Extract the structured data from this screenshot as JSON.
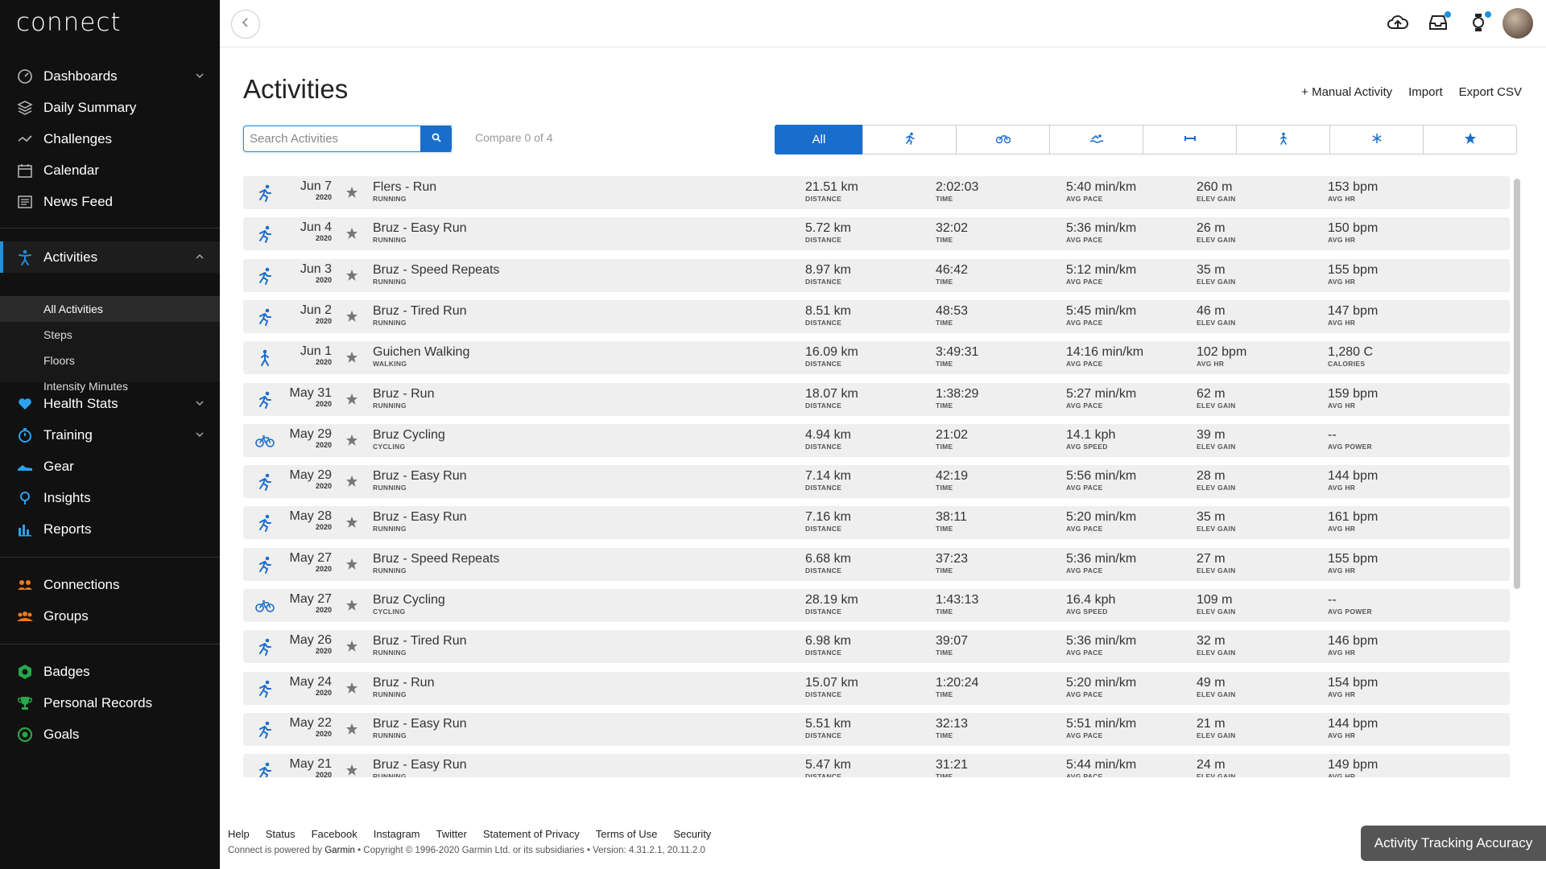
{
  "app": {
    "logo": "connect"
  },
  "sidebar": {
    "items": [
      {
        "label": "Dashboards",
        "icon": "gauge-icon",
        "chevron": "down"
      },
      {
        "label": "Daily Summary",
        "icon": "layers-icon"
      },
      {
        "label": "Challenges",
        "icon": "challenge-icon"
      },
      {
        "label": "Calendar",
        "icon": "calendar-icon"
      },
      {
        "label": "News Feed",
        "icon": "newsfeed-icon"
      }
    ],
    "activities": {
      "label": "Activities",
      "icon": "activities-icon",
      "chevron": "up",
      "sub": [
        "All Activities",
        "Steps",
        "Floors",
        "Intensity Minutes"
      ]
    },
    "items2": [
      {
        "label": "Health Stats",
        "icon": "heart-icon",
        "chevron": "down"
      },
      {
        "label": "Training",
        "icon": "stopwatch-icon",
        "chevron": "down"
      },
      {
        "label": "Gear",
        "icon": "shoe-icon"
      },
      {
        "label": "Insights",
        "icon": "lightbulb-icon"
      },
      {
        "label": "Reports",
        "icon": "bar-chart-icon"
      }
    ],
    "items3": [
      {
        "label": "Connections",
        "icon": "connections-icon"
      },
      {
        "label": "Groups",
        "icon": "groups-icon"
      }
    ],
    "items4": [
      {
        "label": "Badges",
        "icon": "badge-icon"
      },
      {
        "label": "Personal Records",
        "icon": "trophy-icon"
      },
      {
        "label": "Goals",
        "icon": "goal-icon"
      }
    ]
  },
  "header": {
    "title": "Activities",
    "actions": [
      "+ Manual Activity",
      "Import",
      "Export CSV"
    ],
    "search_placeholder": "Search Activities",
    "compare": "Compare 0 of 4",
    "filters": {
      "all": "All"
    }
  },
  "activities": [
    {
      "type_icon": "run",
      "date": "Jun 7",
      "year": "2020",
      "name": "Flers - Run",
      "type": "RUNNING",
      "stats": [
        [
          "21.51 km",
          "DISTANCE"
        ],
        [
          "2:02:03",
          "TIME"
        ],
        [
          "5:40 min/km",
          "AVG PACE"
        ],
        [
          "260 m",
          "ELEV GAIN"
        ],
        [
          "153 bpm",
          "AVG HR"
        ]
      ]
    },
    {
      "type_icon": "run",
      "date": "Jun 4",
      "year": "2020",
      "name": "Bruz - Easy Run",
      "type": "RUNNING",
      "stats": [
        [
          "5.72 km",
          "DISTANCE"
        ],
        [
          "32:02",
          "TIME"
        ],
        [
          "5:36 min/km",
          "AVG PACE"
        ],
        [
          "26 m",
          "ELEV GAIN"
        ],
        [
          "150 bpm",
          "AVG HR"
        ]
      ]
    },
    {
      "type_icon": "run",
      "date": "Jun 3",
      "year": "2020",
      "name": "Bruz - Speed Repeats",
      "type": "RUNNING",
      "stats": [
        [
          "8.97 km",
          "DISTANCE"
        ],
        [
          "46:42",
          "TIME"
        ],
        [
          "5:12 min/km",
          "AVG PACE"
        ],
        [
          "35 m",
          "ELEV GAIN"
        ],
        [
          "155 bpm",
          "AVG HR"
        ]
      ]
    },
    {
      "type_icon": "run",
      "date": "Jun 2",
      "year": "2020",
      "name": "Bruz - Tired Run",
      "type": "RUNNING",
      "stats": [
        [
          "8.51 km",
          "DISTANCE"
        ],
        [
          "48:53",
          "TIME"
        ],
        [
          "5:45 min/km",
          "AVG PACE"
        ],
        [
          "46 m",
          "ELEV GAIN"
        ],
        [
          "147 bpm",
          "AVG HR"
        ]
      ]
    },
    {
      "type_icon": "walk",
      "date": "Jun 1",
      "year": "2020",
      "name": "Guichen Walking",
      "type": "WALKING",
      "stats": [
        [
          "16.09 km",
          "DISTANCE"
        ],
        [
          "3:49:31",
          "TIME"
        ],
        [
          "14:16 min/km",
          "AVG PACE"
        ],
        [
          "102 bpm",
          "AVG HR"
        ],
        [
          "1,280 C",
          "CALORIES"
        ]
      ]
    },
    {
      "type_icon": "run",
      "date": "May 31",
      "year": "2020",
      "name": "Bruz - Run",
      "type": "RUNNING",
      "stats": [
        [
          "18.07 km",
          "DISTANCE"
        ],
        [
          "1:38:29",
          "TIME"
        ],
        [
          "5:27 min/km",
          "AVG PACE"
        ],
        [
          "62 m",
          "ELEV GAIN"
        ],
        [
          "159 bpm",
          "AVG HR"
        ]
      ]
    },
    {
      "type_icon": "bike",
      "date": "May 29",
      "year": "2020",
      "name": "Bruz Cycling",
      "type": "CYCLING",
      "stats": [
        [
          "4.94 km",
          "DISTANCE"
        ],
        [
          "21:02",
          "TIME"
        ],
        [
          "14.1 kph",
          "AVG SPEED"
        ],
        [
          "39 m",
          "ELEV GAIN"
        ],
        [
          "--",
          "AVG POWER"
        ]
      ]
    },
    {
      "type_icon": "run",
      "date": "May 29",
      "year": "2020",
      "name": "Bruz - Easy Run",
      "type": "RUNNING",
      "stats": [
        [
          "7.14 km",
          "DISTANCE"
        ],
        [
          "42:19",
          "TIME"
        ],
        [
          "5:56 min/km",
          "AVG PACE"
        ],
        [
          "28 m",
          "ELEV GAIN"
        ],
        [
          "144 bpm",
          "AVG HR"
        ]
      ]
    },
    {
      "type_icon": "run",
      "date": "May 28",
      "year": "2020",
      "name": "Bruz - Easy Run",
      "type": "RUNNING",
      "stats": [
        [
          "7.16 km",
          "DISTANCE"
        ],
        [
          "38:11",
          "TIME"
        ],
        [
          "5:20 min/km",
          "AVG PACE"
        ],
        [
          "35 m",
          "ELEV GAIN"
        ],
        [
          "161 bpm",
          "AVG HR"
        ]
      ]
    },
    {
      "type_icon": "run",
      "date": "May 27",
      "year": "2020",
      "name": "Bruz - Speed Repeats",
      "type": "RUNNING",
      "stats": [
        [
          "6.68 km",
          "DISTANCE"
        ],
        [
          "37:23",
          "TIME"
        ],
        [
          "5:36 min/km",
          "AVG PACE"
        ],
        [
          "27 m",
          "ELEV GAIN"
        ],
        [
          "155 bpm",
          "AVG HR"
        ]
      ]
    },
    {
      "type_icon": "bike",
      "date": "May 27",
      "year": "2020",
      "name": "Bruz Cycling",
      "type": "CYCLING",
      "stats": [
        [
          "28.19 km",
          "DISTANCE"
        ],
        [
          "1:43:13",
          "TIME"
        ],
        [
          "16.4 kph",
          "AVG SPEED"
        ],
        [
          "109 m",
          "ELEV GAIN"
        ],
        [
          "--",
          "AVG POWER"
        ]
      ]
    },
    {
      "type_icon": "run",
      "date": "May 26",
      "year": "2020",
      "name": "Bruz - Tired Run",
      "type": "RUNNING",
      "stats": [
        [
          "6.98 km",
          "DISTANCE"
        ],
        [
          "39:07",
          "TIME"
        ],
        [
          "5:36 min/km",
          "AVG PACE"
        ],
        [
          "32 m",
          "ELEV GAIN"
        ],
        [
          "146 bpm",
          "AVG HR"
        ]
      ]
    },
    {
      "type_icon": "run",
      "date": "May 24",
      "year": "2020",
      "name": "Bruz - Run",
      "type": "RUNNING",
      "stats": [
        [
          "15.07 km",
          "DISTANCE"
        ],
        [
          "1:20:24",
          "TIME"
        ],
        [
          "5:20 min/km",
          "AVG PACE"
        ],
        [
          "49 m",
          "ELEV GAIN"
        ],
        [
          "154 bpm",
          "AVG HR"
        ]
      ]
    },
    {
      "type_icon": "run",
      "date": "May 22",
      "year": "2020",
      "name": "Bruz - Easy Run",
      "type": "RUNNING",
      "stats": [
        [
          "5.51 km",
          "DISTANCE"
        ],
        [
          "32:13",
          "TIME"
        ],
        [
          "5:51 min/km",
          "AVG PACE"
        ],
        [
          "21 m",
          "ELEV GAIN"
        ],
        [
          "144 bpm",
          "AVG HR"
        ]
      ]
    },
    {
      "type_icon": "run",
      "date": "May 21",
      "year": "2020",
      "name": "Bruz - Easy Run",
      "type": "RUNNING",
      "stats": [
        [
          "5.47 km",
          "DISTANCE"
        ],
        [
          "31:21",
          "TIME"
        ],
        [
          "5:44 min/km",
          "AVG PACE"
        ],
        [
          "24 m",
          "ELEV GAIN"
        ],
        [
          "149 bpm",
          "AVG HR"
        ]
      ]
    }
  ],
  "footer": {
    "links": [
      "Help",
      "Status",
      "Facebook",
      "Instagram",
      "Twitter",
      "Statement of Privacy",
      "Terms of Use",
      "Security"
    ],
    "copy_prefix": "Connect is powered by ",
    "copy_brand": "Garmin",
    "copy_suffix": " • Copyright © 1996-2020 Garmin Ltd. or its subsidiaries • Version: 4.31.2.1, 20.11.2.0",
    "accuracy": "Activity Tracking Accuracy"
  },
  "colors": {
    "accent": "#1a6ecb",
    "sidebar_bg": "#111111",
    "row_bg": "#efefef",
    "icon_blue": "#1a6ecb"
  }
}
